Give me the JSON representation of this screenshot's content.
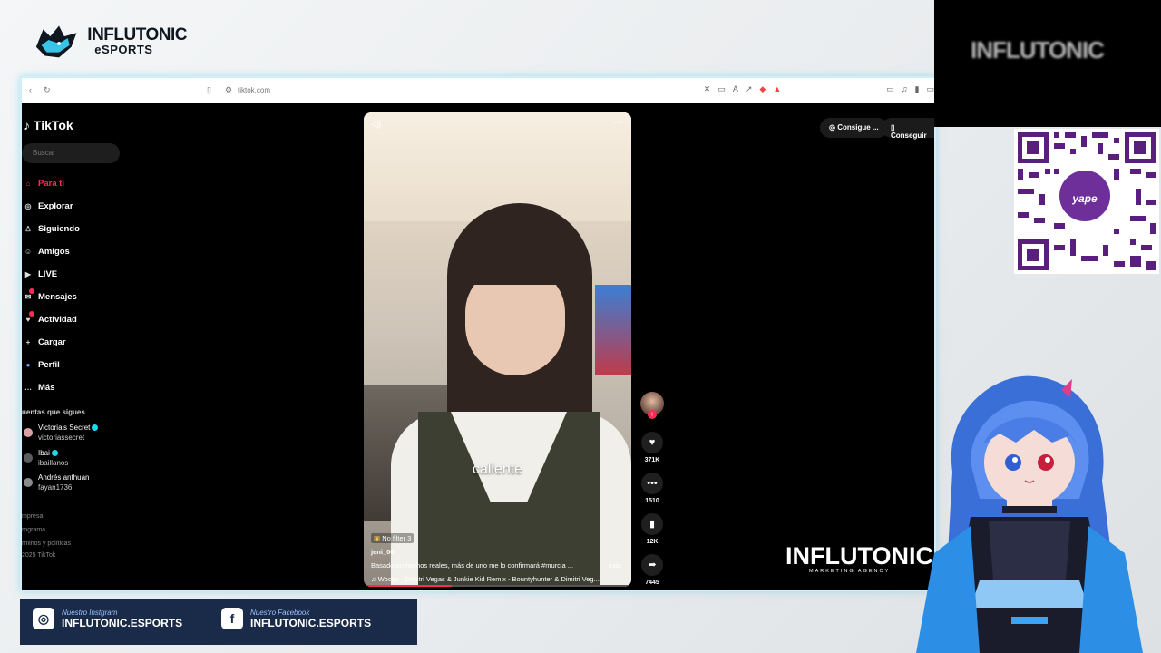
{
  "overlay": {
    "brand_line1": "INFLUTONIC",
    "brand_line2": "eSPORTS",
    "cam_text": "INFLUTONIC",
    "yape_label": "yape",
    "watermark": "INFLUTONIC",
    "watermark_sub": "MARKETING AGENCY",
    "instagram_caption": "Nuestro Instgram",
    "instagram_handle": "INFLUTONIC.ESPORTS",
    "facebook_caption": "Nuestro Facebook",
    "facebook_handle": "INFLUTONIC.ESPORTS",
    "colors": {
      "accent_blue": "#1a2a49",
      "overlay_bg": "#eceff1"
    }
  },
  "browser": {
    "url": "tiktok.com"
  },
  "tiktok": {
    "logo": "TikTok",
    "search_placeholder": "Buscar",
    "nav": [
      {
        "label": "Para ti",
        "icon": "home-icon",
        "active": true
      },
      {
        "label": "Explorar",
        "icon": "compass-icon"
      },
      {
        "label": "Siguiendo",
        "icon": "following-icon"
      },
      {
        "label": "Amigos",
        "icon": "friends-icon"
      },
      {
        "label": "LIVE",
        "icon": "live-icon"
      },
      {
        "label": "Mensajes",
        "icon": "messages-icon",
        "badge": "3"
      },
      {
        "label": "Actividad",
        "icon": "activity-icon",
        "badge": "6"
      },
      {
        "label": "Cargar",
        "icon": "upload-icon"
      },
      {
        "label": "Perfil",
        "icon": "profile-icon"
      },
      {
        "label": "Más",
        "icon": "more-icon"
      }
    ],
    "following_title": "uentas que sigues",
    "following": [
      {
        "name": "Victoria's Secret",
        "user": "victoriassecret",
        "verified": true
      },
      {
        "name": "Ibai",
        "user": "ibaillanos",
        "verified": true
      },
      {
        "name": "Andrés anthuan",
        "user": "fayan1736",
        "verified": false
      }
    ],
    "footer": [
      "mpresa",
      "rograma",
      "rminos y políticas",
      "2025 TikTok"
    ],
    "pills": [
      "Consigue ...",
      "Conseguir"
    ],
    "video": {
      "overlay_text": "caliente",
      "tag": "No filter 3",
      "author": "jeni_00",
      "description": "Basado en hechos reales, más de uno me lo confirmará #murcia ...",
      "more": "más",
      "music": "♫ Woops - Dimitri Vegas & Junkie Kid Remix - Bountyhunter & Dimitri Veg...",
      "progress": 0.33
    },
    "actions": {
      "likes": "371K",
      "comments": "1510",
      "saves": "12K",
      "shares": "7445"
    }
  }
}
